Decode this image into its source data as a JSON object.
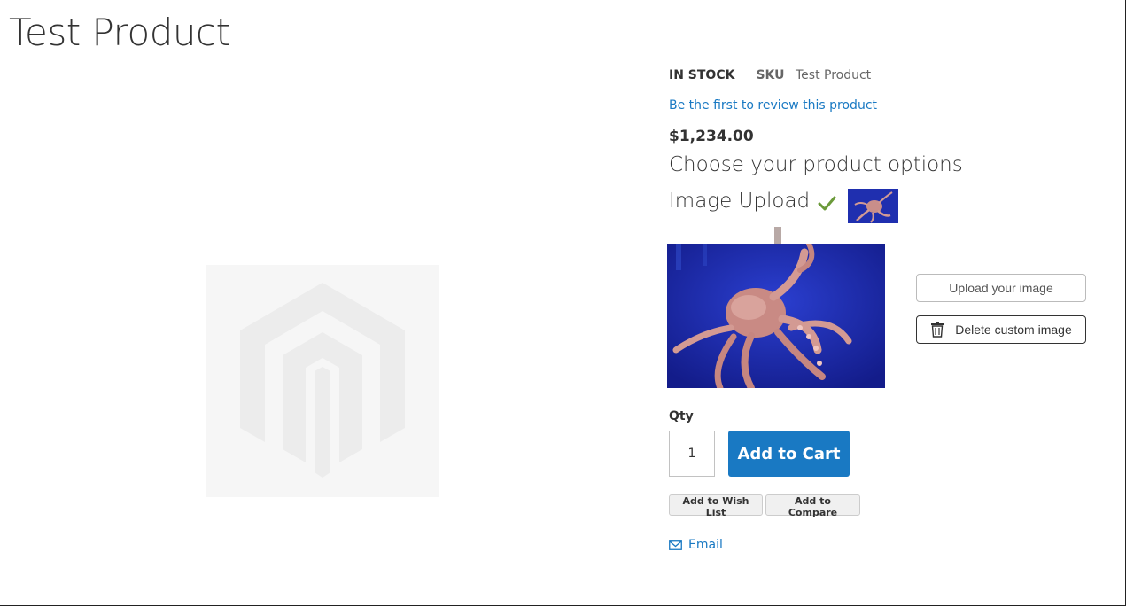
{
  "product": {
    "title": "Test Product",
    "stock_status": "IN STOCK",
    "sku_label": "SKU",
    "sku_value": "Test Product",
    "review_link": "Be the first to review this product",
    "price": "$1,234.00"
  },
  "options": {
    "heading": "Choose your product options",
    "image_upload_label": "Image Upload",
    "upload_button": "Upload your image",
    "delete_button": "Delete custom image"
  },
  "cart": {
    "qty_label": "Qty",
    "qty_value": "1",
    "add_to_cart": "Add to Cart",
    "wish_list": "Add to Wish List",
    "compare": "Add to Compare",
    "email": "Email"
  },
  "colors": {
    "link": "#1979c3",
    "primary_button": "#1979c3",
    "check": "#6b9a3a",
    "placeholder_bg": "#f6f6f6"
  },
  "icons": [
    "magento-placeholder-logo",
    "check-icon",
    "trash-icon",
    "email-icon"
  ]
}
